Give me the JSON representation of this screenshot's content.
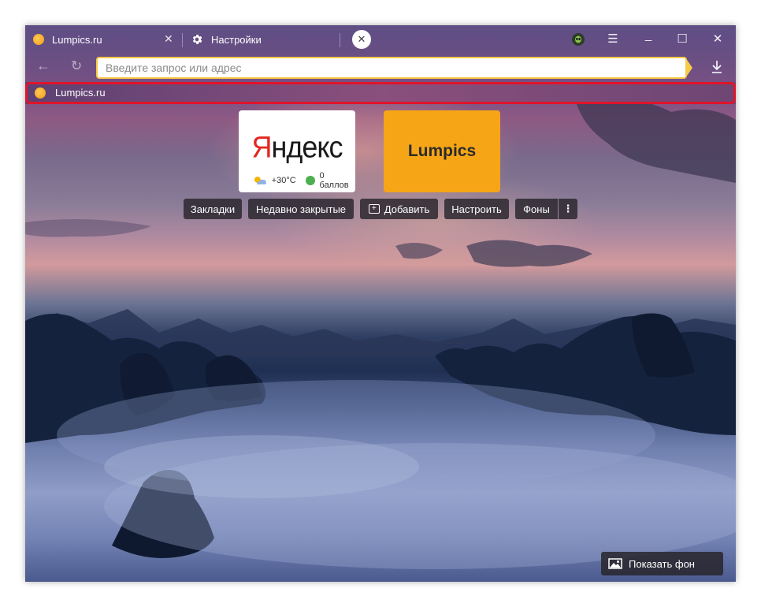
{
  "tabs": [
    {
      "label": "Lumpics.ru",
      "icon": "lumpics-favicon-icon"
    },
    {
      "label": "Настройки",
      "icon": "gear-icon"
    }
  ],
  "omnibox": {
    "placeholder": "Введите запрос или адрес",
    "value": ""
  },
  "bookmarks_bar": {
    "items": [
      {
        "label": "Lumpics.ru",
        "icon": "lumpics-favicon-icon"
      }
    ]
  },
  "tiles": {
    "yandex": {
      "logo_first": "Я",
      "logo_rest": "ндекс",
      "weather": "+30°C",
      "points": "0 баллов"
    },
    "lumpics": {
      "label": "Lumpics"
    }
  },
  "actions": {
    "bookmarks": "Закладки",
    "recently_closed": "Недавно закрытые",
    "add": "Добавить",
    "customize": "Настроить",
    "backgrounds": "Фоны",
    "more": "⋮"
  },
  "show_background": "Показать фон",
  "colors": {
    "accent": "#f7c948",
    "lumpics_tile": "#f5a516",
    "highlight": "#e0142b",
    "yandex_red": "#e52620"
  }
}
